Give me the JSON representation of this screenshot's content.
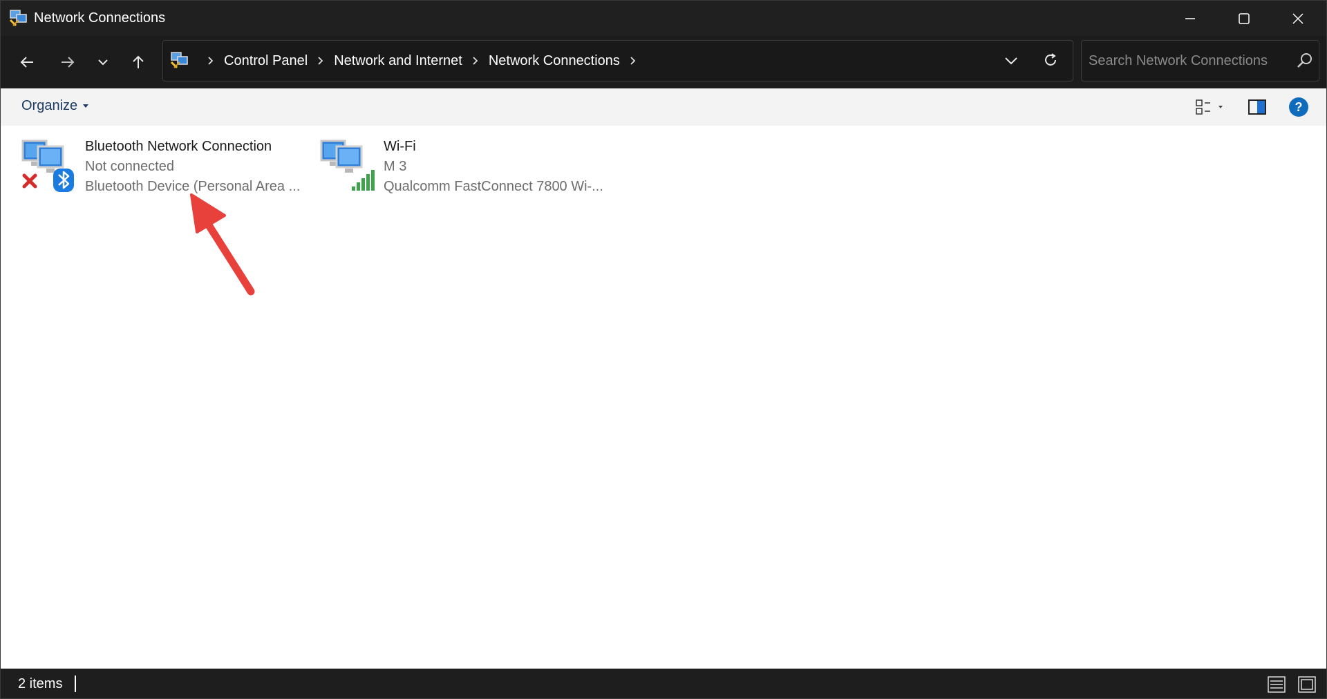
{
  "window": {
    "title": "Network Connections"
  },
  "address_bar": {
    "breadcrumbs": [
      "Control Panel",
      "Network and Internet",
      "Network Connections"
    ]
  },
  "search": {
    "placeholder": "Search Network Connections"
  },
  "command_bar": {
    "organize_label": "Organize"
  },
  "items": [
    {
      "name": "Bluetooth Network Connection",
      "status": "Not connected",
      "device": "Bluetooth Device (Personal Area ...",
      "icon": "network-computers-icon",
      "overlay_icons": [
        "red-x-icon",
        "bluetooth-icon"
      ]
    },
    {
      "name": "Wi-Fi",
      "status": "M 3",
      "device": "Qualcomm FastConnect 7800 Wi-...",
      "icon": "network-computers-icon",
      "overlay_icons": [
        "signal-bars-icon"
      ]
    }
  ],
  "status_bar": {
    "item_count": "2 items"
  },
  "colors": {
    "titlebar": "#202020",
    "navbar": "#1c1c1c",
    "command_bar": "#f3f3f3",
    "annotation_arrow": "#e8403a",
    "help_blue": "#0f6cbd"
  }
}
